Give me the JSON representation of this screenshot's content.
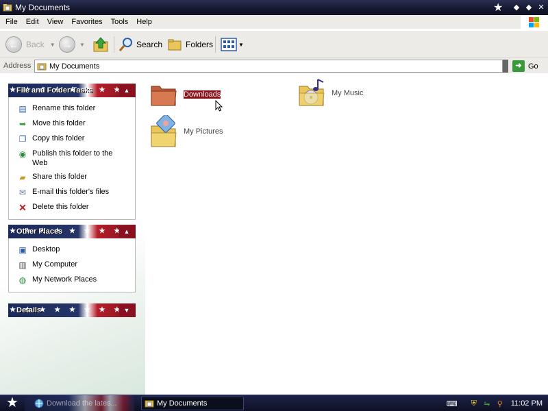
{
  "window": {
    "title": "My Documents"
  },
  "menu": {
    "items": [
      "File",
      "Edit",
      "View",
      "Favorites",
      "Tools",
      "Help"
    ]
  },
  "toolbar": {
    "back_label": "Back",
    "search_label": "Search",
    "folders_label": "Folders"
  },
  "address": {
    "label": "Address",
    "value": "My Documents",
    "go_label": "Go"
  },
  "panels": {
    "file_tasks": {
      "title": "File and Folder Tasks",
      "items": [
        {
          "label": "Rename this folder",
          "icon": "rename-icon"
        },
        {
          "label": "Move this folder",
          "icon": "move-icon"
        },
        {
          "label": "Copy this folder",
          "icon": "copy-icon"
        },
        {
          "label": "Publish this folder to the Web",
          "icon": "publish-web-icon"
        },
        {
          "label": "Share this folder",
          "icon": "share-icon"
        },
        {
          "label": "E-mail this folder's files",
          "icon": "email-icon"
        },
        {
          "label": "Delete this folder",
          "icon": "delete-icon"
        }
      ]
    },
    "other_places": {
      "title": "Other Places",
      "items": [
        {
          "label": "Desktop",
          "icon": "desktop-icon"
        },
        {
          "label": "My Computer",
          "icon": "my-computer-icon"
        },
        {
          "label": "My Network Places",
          "icon": "network-places-icon"
        }
      ]
    },
    "details": {
      "title": "Details"
    }
  },
  "files": [
    {
      "name": "Downloads",
      "selected": true,
      "icon": "folder-icon"
    },
    {
      "name": "My Music",
      "selected": false,
      "icon": "music-folder-icon"
    },
    {
      "name": "My Pictures",
      "selected": false,
      "icon": "pictures-folder-icon"
    }
  ],
  "taskbar": {
    "tasks": [
      {
        "label": "Download the lates...",
        "active": false
      },
      {
        "label": "My Documents",
        "active": true
      }
    ],
    "clock": "11:02 PM"
  },
  "colors": {
    "selection": "#8b1119",
    "titlebar": "#14182e",
    "flag_blue": "#253467",
    "flag_red": "#b41e2a"
  }
}
